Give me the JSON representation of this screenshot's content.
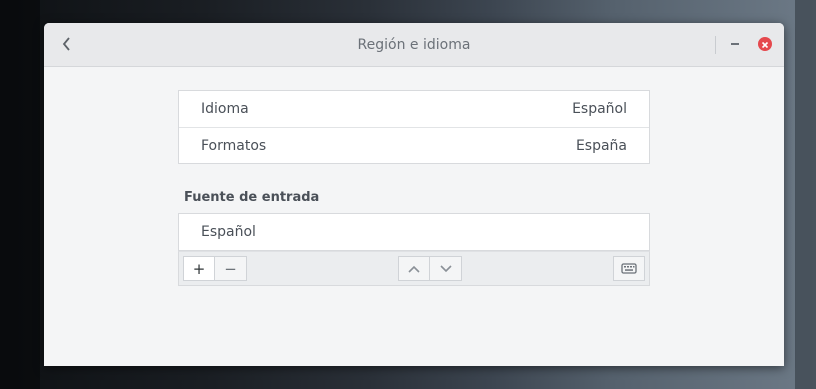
{
  "window": {
    "title": "Región e idioma"
  },
  "settings": [
    {
      "label": "Idioma",
      "value": "Español"
    },
    {
      "label": "Formatos",
      "value": "España"
    }
  ],
  "input_sources": {
    "heading": "Fuente de entrada",
    "items": [
      "Español"
    ]
  },
  "toolbar": {
    "add_glyph": "+",
    "remove_glyph": "−"
  }
}
